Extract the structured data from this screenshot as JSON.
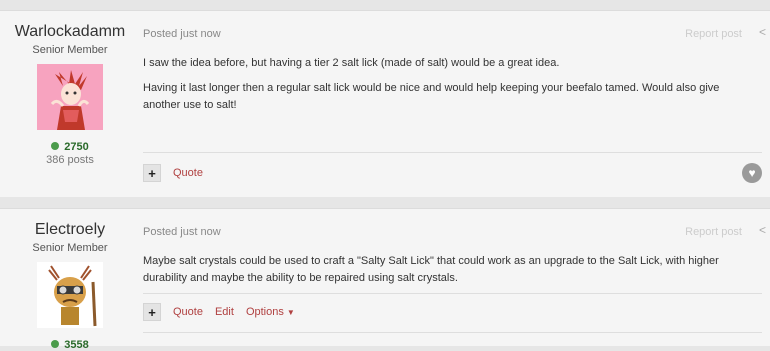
{
  "posts": [
    {
      "author": "Warlockadamm",
      "rank": "Senior Member",
      "reputation": "2750",
      "post_count": "386 posts",
      "meta": "Posted just now",
      "report": "Report post",
      "share_icon": "share-icon",
      "paragraphs": [
        "I saw the idea before, but having a tier 2 salt lick (made of salt) would be a great idea.",
        "Having it last longer then a regular salt lick would be nice and would help keeping your beefalo tamed. Would also give another use to salt!"
      ],
      "actions": {
        "multiquote": "+",
        "quote": "Quote"
      },
      "like_icon": "heart-icon"
    },
    {
      "author": "Electroely",
      "rank": "Senior Member",
      "reputation": "3558",
      "meta": "Posted just now",
      "report": "Report post",
      "share_icon": "share-icon",
      "paragraphs": [
        "Maybe salt crystals could be used to craft a \"Salty Salt Lick\" that could work as an upgrade to the Salt Lick, with higher durability and maybe the ability to be repaired using salt crystals."
      ],
      "actions": {
        "multiquote": "+",
        "quote": "Quote",
        "edit": "Edit",
        "options": "Options"
      }
    }
  ],
  "colors": {
    "background": "#e6e6e6",
    "post": "#f5f5f5",
    "link": "#b04040",
    "reputation": "#2a6a2a"
  }
}
